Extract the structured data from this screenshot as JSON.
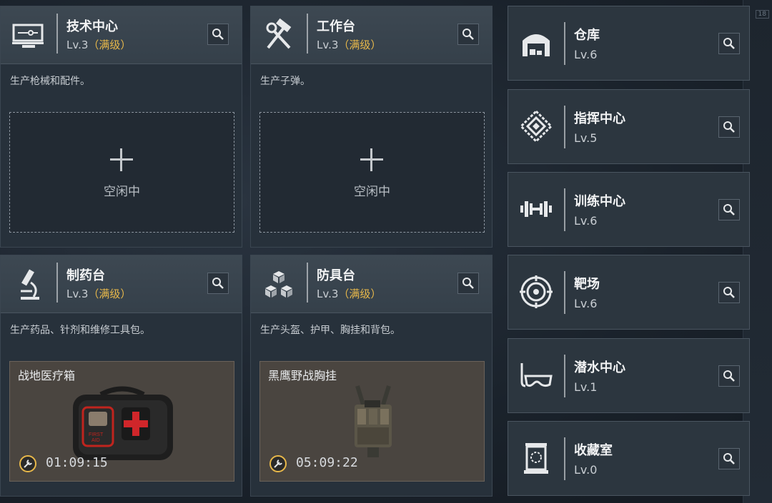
{
  "left_cards": [
    {
      "title": "技术中心",
      "lv_prefix": "Lv.3",
      "lv_max": "（满级）",
      "desc": "生产枪械和配件。",
      "idle": "空闲中"
    },
    {
      "title": "工作台",
      "lv_prefix": "Lv.3",
      "lv_max": "（满级）",
      "desc": "生产子弹。",
      "idle": "空闲中"
    },
    {
      "title": "制药台",
      "lv_prefix": "Lv.3",
      "lv_max": "（满级）",
      "desc": "生产药品、针剂和维修工具包。",
      "product": "战地医疗箱",
      "timer": "01:09:15"
    },
    {
      "title": "防具台",
      "lv_prefix": "Lv.3",
      "lv_max": "（满级）",
      "desc": "生产头盔、护甲、胸挂和背包。",
      "product": "黑鹰野战胸挂",
      "timer": "05:09:22"
    }
  ],
  "right_cards": [
    {
      "title": "仓库",
      "lv": "Lv.6",
      "icon": "warehouse-icon"
    },
    {
      "title": "指挥中心",
      "lv": "Lv.5",
      "icon": "command-icon"
    },
    {
      "title": "训练中心",
      "lv": "Lv.6",
      "icon": "dumbbell-icon"
    },
    {
      "title": "靶场",
      "lv": "Lv.6",
      "icon": "target-icon"
    },
    {
      "title": "潜水中心",
      "lv": "Lv.1",
      "icon": "diving-mask-icon"
    },
    {
      "title": "收藏室",
      "lv": "Lv.0",
      "icon": "collection-icon"
    }
  ],
  "edge_label": "18",
  "colors": {
    "accent_gold": "#e8b84a",
    "panel": "#27313b",
    "header": "#3d4852"
  }
}
